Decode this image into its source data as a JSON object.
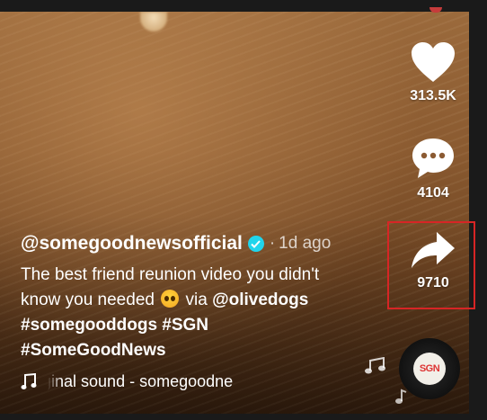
{
  "post": {
    "handle": "@somegoodnewsofficial",
    "separator": "·",
    "time_ago": "1d ago",
    "description_line1": "The best friend reunion video you didn't",
    "description_line2a": "know you needed",
    "description_line2b": "via",
    "mention": "@olivedogs",
    "hashtags_line1": "#somegooddogs #SGN",
    "hashtags_line2": "#SomeGoodNews"
  },
  "actions": {
    "likes": "313.5K",
    "comments": "4104",
    "shares": "9710"
  },
  "sound": {
    "text": "original sound - somegoodne",
    "disc_label": "SGN"
  },
  "icons": [
    "heart-icon",
    "comment-icon",
    "share-icon",
    "verified-icon",
    "music-note-icon",
    "pleading-face-emoji"
  ],
  "colors": {
    "highlight_box": "#d72525",
    "verified": "#20d5ec"
  }
}
